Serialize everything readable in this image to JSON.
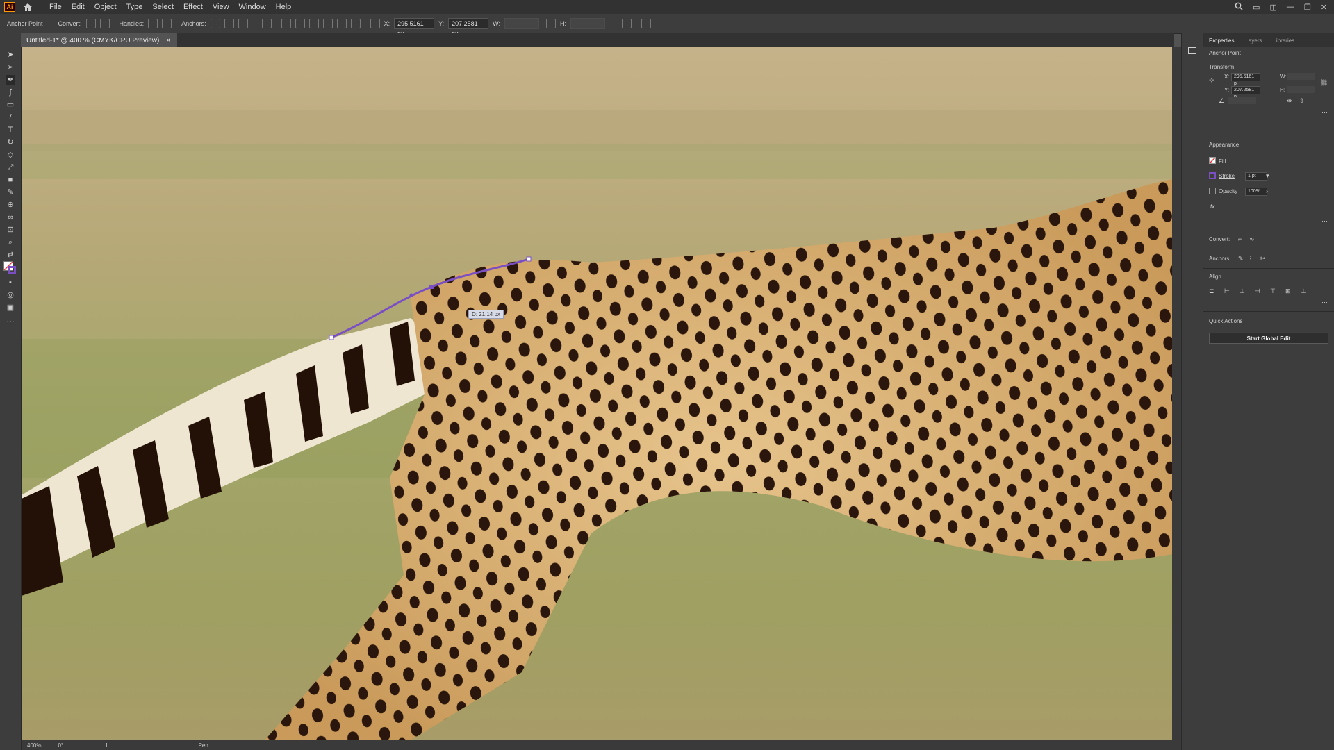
{
  "menubar": {
    "app_logo": "Ai",
    "items": [
      "File",
      "Edit",
      "Object",
      "Type",
      "Select",
      "Effect",
      "View",
      "Window",
      "Help"
    ]
  },
  "control_bar": {
    "selection_type": "Anchor Point",
    "convert_label": "Convert:",
    "handles_label": "Handles:",
    "anchors_label": "Anchors:",
    "x_label": "X:",
    "x_value": "295.5161 px",
    "y_label": "Y:",
    "y_value": "207.2581 px",
    "w_label": "W:",
    "h_label": "H:"
  },
  "document": {
    "tab_title": "Untitled-1* @ 400 % (CMYK/CPU Preview)",
    "close_symbol": "×"
  },
  "canvas": {
    "tooltip": "D: 21.14 px",
    "path_color": "#7b4fc4"
  },
  "status_bar": {
    "zoom": "400%",
    "rotation": "0°",
    "artboard": "1",
    "tool": "Pen"
  },
  "properties_panel": {
    "tabs": [
      "Properties",
      "Layers",
      "Libraries"
    ],
    "selection": "Anchor Point",
    "transform_title": "Transform",
    "x_label": "X:",
    "x_value": "295.5161 p",
    "y_label": "Y:",
    "y_value": "207.2581 p",
    "w_label": "W:",
    "h_label": "H:",
    "appearance_title": "Appearance",
    "fill_label": "Fill",
    "stroke_label": "Stroke",
    "stroke_value": "1 pt",
    "opacity_label": "Opacity",
    "opacity_value": "100%",
    "fx_label": "fx.",
    "convert_label": "Convert:",
    "anchors_label": "Anchors:",
    "align_title": "Align",
    "quick_actions_title": "Quick Actions",
    "start_global_edit": "Start Global Edit"
  }
}
